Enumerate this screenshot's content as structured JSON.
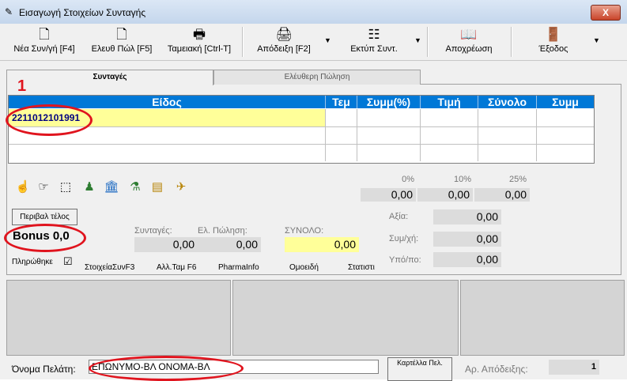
{
  "window": {
    "title": "Εισαγωγή Στοιχείων Συνταγής",
    "close": "X"
  },
  "toolbar": {
    "new": "Νέα Συν/γή [F4]",
    "free_sale": "Ελευθ Πώλ [F5]",
    "cash": "Ταμειακή [Ctrl-T]",
    "receipt": "Απόδειξη [F2]",
    "print": "Εκτύπ Συντ.",
    "save": "Αποχρέωση",
    "exit": "Έξοδος",
    "arrow": "▼"
  },
  "tabs": {
    "prescriptions": "Συνταγές",
    "free_sale": "Ελέυθερη Πώληση"
  },
  "annotation": "1",
  "grid": {
    "columns": [
      "Είδος",
      "Τεμ",
      "Συμμ(%)",
      "Τιμή",
      "Σύνολο",
      "Συμμ"
    ],
    "first_value": "2211012101991"
  },
  "percent": {
    "labels": [
      "0%",
      "10%",
      "25%"
    ],
    "values": [
      "0,00",
      "0,00",
      "0,00"
    ]
  },
  "bonus_button": "Περιβαλ τέλος",
  "bonus": "Bonus 0,0",
  "paid": {
    "label": "Πληρώθηκε",
    "check": "☑"
  },
  "totals": {
    "prescriptions_label": "Συνταγές:",
    "prescriptions_value": "0,00",
    "free_sale_label": "Ελ. Πώληση:",
    "free_sale_value": "0,00",
    "total_label": "ΣΥΝΟΛΟ:",
    "total_value": "0,00"
  },
  "right": {
    "value_label": "Αξία:",
    "value": "0,00",
    "part_label": "Συμ/χή:",
    "part": "0,00",
    "rest_label": "Υπό/πο:",
    "rest": "0,00"
  },
  "links": [
    "ΣτοιχείαΣυνF3",
    "Αλλ.Ταμ F6",
    "PharmaInfo",
    "Ομοειδή",
    "Στατιστι"
  ],
  "customer": {
    "label": "Όνομα Πελάτη:",
    "value": "ΕΠΩΝΥΜΟ-ΒΛ ΟΝΟΜΑ-ΒΛ"
  },
  "card_button": "Καρτέλλα Πελ.",
  "receipt_no": {
    "label": "Αρ. Απόδειξης:",
    "value": "1"
  }
}
